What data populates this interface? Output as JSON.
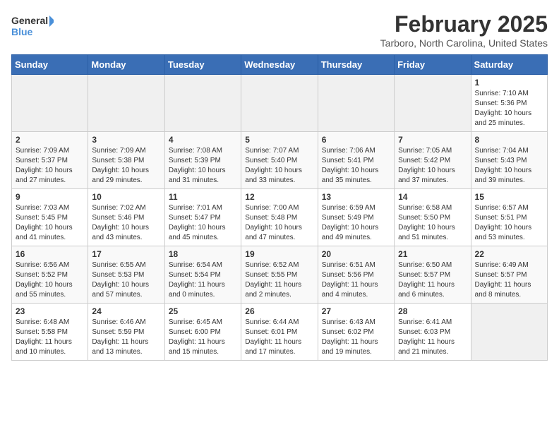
{
  "logo": {
    "line1": "General",
    "line2": "Blue"
  },
  "title": "February 2025",
  "location": "Tarboro, North Carolina, United States",
  "days_of_week": [
    "Sunday",
    "Monday",
    "Tuesday",
    "Wednesday",
    "Thursday",
    "Friday",
    "Saturday"
  ],
  "weeks": [
    [
      {
        "day": "",
        "info": ""
      },
      {
        "day": "",
        "info": ""
      },
      {
        "day": "",
        "info": ""
      },
      {
        "day": "",
        "info": ""
      },
      {
        "day": "",
        "info": ""
      },
      {
        "day": "",
        "info": ""
      },
      {
        "day": "1",
        "info": "Sunrise: 7:10 AM\nSunset: 5:36 PM\nDaylight: 10 hours\nand 25 minutes."
      }
    ],
    [
      {
        "day": "2",
        "info": "Sunrise: 7:09 AM\nSunset: 5:37 PM\nDaylight: 10 hours\nand 27 minutes."
      },
      {
        "day": "3",
        "info": "Sunrise: 7:09 AM\nSunset: 5:38 PM\nDaylight: 10 hours\nand 29 minutes."
      },
      {
        "day": "4",
        "info": "Sunrise: 7:08 AM\nSunset: 5:39 PM\nDaylight: 10 hours\nand 31 minutes."
      },
      {
        "day": "5",
        "info": "Sunrise: 7:07 AM\nSunset: 5:40 PM\nDaylight: 10 hours\nand 33 minutes."
      },
      {
        "day": "6",
        "info": "Sunrise: 7:06 AM\nSunset: 5:41 PM\nDaylight: 10 hours\nand 35 minutes."
      },
      {
        "day": "7",
        "info": "Sunrise: 7:05 AM\nSunset: 5:42 PM\nDaylight: 10 hours\nand 37 minutes."
      },
      {
        "day": "8",
        "info": "Sunrise: 7:04 AM\nSunset: 5:43 PM\nDaylight: 10 hours\nand 39 minutes."
      }
    ],
    [
      {
        "day": "9",
        "info": "Sunrise: 7:03 AM\nSunset: 5:45 PM\nDaylight: 10 hours\nand 41 minutes."
      },
      {
        "day": "10",
        "info": "Sunrise: 7:02 AM\nSunset: 5:46 PM\nDaylight: 10 hours\nand 43 minutes."
      },
      {
        "day": "11",
        "info": "Sunrise: 7:01 AM\nSunset: 5:47 PM\nDaylight: 10 hours\nand 45 minutes."
      },
      {
        "day": "12",
        "info": "Sunrise: 7:00 AM\nSunset: 5:48 PM\nDaylight: 10 hours\nand 47 minutes."
      },
      {
        "day": "13",
        "info": "Sunrise: 6:59 AM\nSunset: 5:49 PM\nDaylight: 10 hours\nand 49 minutes."
      },
      {
        "day": "14",
        "info": "Sunrise: 6:58 AM\nSunset: 5:50 PM\nDaylight: 10 hours\nand 51 minutes."
      },
      {
        "day": "15",
        "info": "Sunrise: 6:57 AM\nSunset: 5:51 PM\nDaylight: 10 hours\nand 53 minutes."
      }
    ],
    [
      {
        "day": "16",
        "info": "Sunrise: 6:56 AM\nSunset: 5:52 PM\nDaylight: 10 hours\nand 55 minutes."
      },
      {
        "day": "17",
        "info": "Sunrise: 6:55 AM\nSunset: 5:53 PM\nDaylight: 10 hours\nand 57 minutes."
      },
      {
        "day": "18",
        "info": "Sunrise: 6:54 AM\nSunset: 5:54 PM\nDaylight: 11 hours\nand 0 minutes."
      },
      {
        "day": "19",
        "info": "Sunrise: 6:52 AM\nSunset: 5:55 PM\nDaylight: 11 hours\nand 2 minutes."
      },
      {
        "day": "20",
        "info": "Sunrise: 6:51 AM\nSunset: 5:56 PM\nDaylight: 11 hours\nand 4 minutes."
      },
      {
        "day": "21",
        "info": "Sunrise: 6:50 AM\nSunset: 5:57 PM\nDaylight: 11 hours\nand 6 minutes."
      },
      {
        "day": "22",
        "info": "Sunrise: 6:49 AM\nSunset: 5:57 PM\nDaylight: 11 hours\nand 8 minutes."
      }
    ],
    [
      {
        "day": "23",
        "info": "Sunrise: 6:48 AM\nSunset: 5:58 PM\nDaylight: 11 hours\nand 10 minutes."
      },
      {
        "day": "24",
        "info": "Sunrise: 6:46 AM\nSunset: 5:59 PM\nDaylight: 11 hours\nand 13 minutes."
      },
      {
        "day": "25",
        "info": "Sunrise: 6:45 AM\nSunset: 6:00 PM\nDaylight: 11 hours\nand 15 minutes."
      },
      {
        "day": "26",
        "info": "Sunrise: 6:44 AM\nSunset: 6:01 PM\nDaylight: 11 hours\nand 17 minutes."
      },
      {
        "day": "27",
        "info": "Sunrise: 6:43 AM\nSunset: 6:02 PM\nDaylight: 11 hours\nand 19 minutes."
      },
      {
        "day": "28",
        "info": "Sunrise: 6:41 AM\nSunset: 6:03 PM\nDaylight: 11 hours\nand 21 minutes."
      },
      {
        "day": "",
        "info": ""
      }
    ]
  ]
}
